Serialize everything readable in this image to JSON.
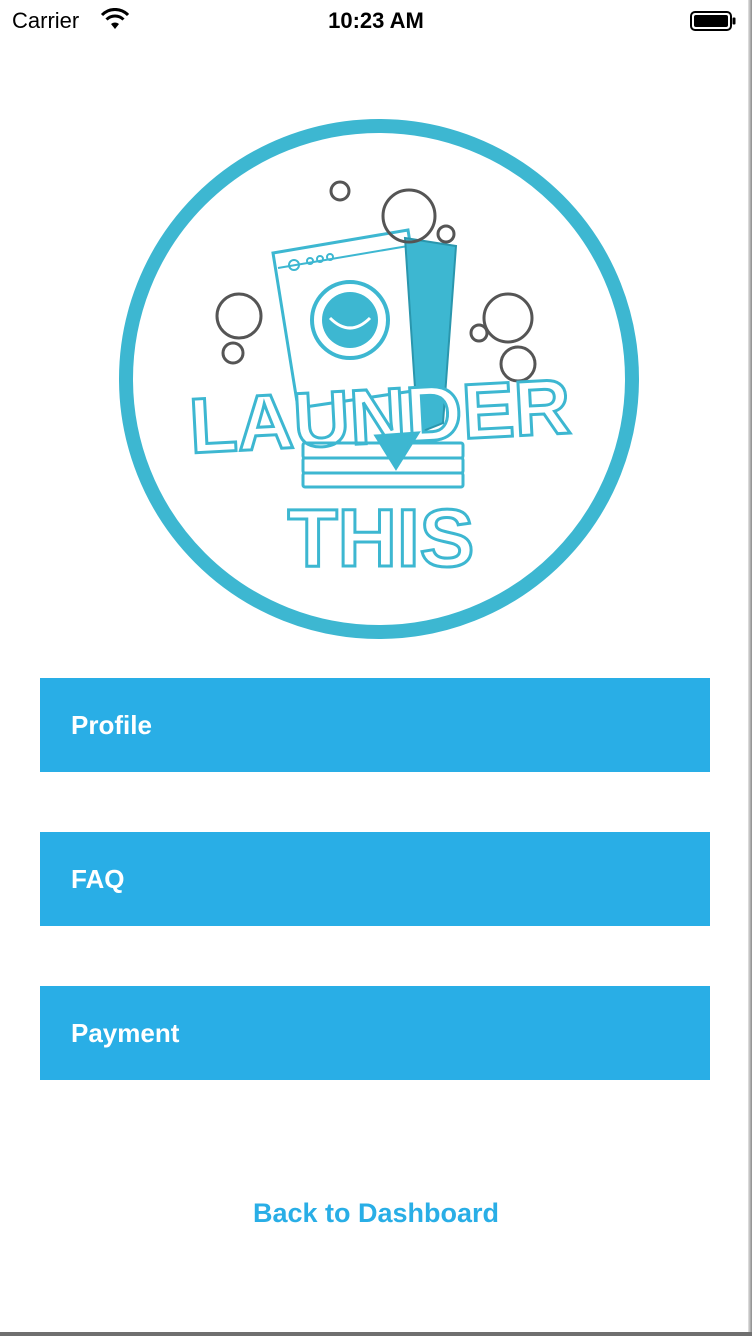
{
  "status_bar": {
    "carrier": "Carrier",
    "time": "10:23 AM",
    "wifi_icon": "wifi-icon",
    "battery_icon": "battery-icon"
  },
  "logo": {
    "name": "launder-this-logo",
    "word_top": "LAUNDER",
    "word_bottom": "THIS",
    "accent_color": "#3db7d1"
  },
  "menu": {
    "items": [
      {
        "label": "Profile"
      },
      {
        "label": "FAQ"
      },
      {
        "label": "Payment"
      }
    ],
    "button_color": "#29aee6"
  },
  "footer": {
    "back_label": "Back to Dashboard"
  }
}
